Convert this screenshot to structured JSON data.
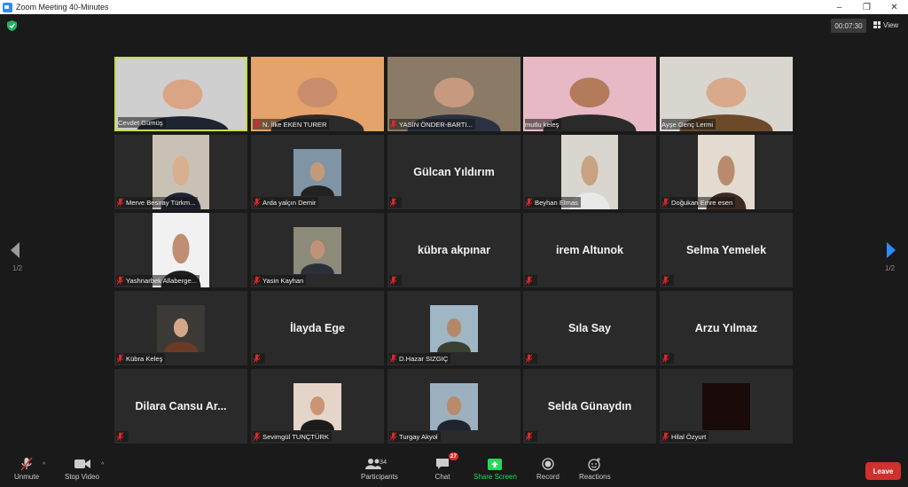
{
  "window": {
    "title": "Zoom Meeting 40-Minutes",
    "controls": [
      "–",
      "❐",
      "✕"
    ]
  },
  "meeting": {
    "timer": "00:07:30",
    "view_label": "View",
    "page_left": "1/2",
    "page_right": "1/2"
  },
  "colors": {
    "background": "#1a1a1a",
    "tile": "#2a2a2a",
    "active_speaker": "#c7dc4c",
    "muted_red": "#e02828",
    "share_green": "#23d959",
    "leave_red": "#d0312d",
    "security_green": "#1fb35c"
  },
  "participants": [
    {
      "name": "Cevdet Gümüş",
      "video": true,
      "muted": false,
      "active": true,
      "bg": "#cfcfcf",
      "fg": "#1e2430",
      "skin": "#d9a584"
    },
    {
      "name": "N. İlke EKEN TURER",
      "video": true,
      "muted": true,
      "bg": "#e4a36a",
      "fg": "#2b2b2b",
      "skin": "#c98d6e"
    },
    {
      "name": "YASİN ÖNDER-BARTI...",
      "video": true,
      "muted": true,
      "bg": "#8a7a66",
      "fg": "#2b3142",
      "skin": "#c79a80"
    },
    {
      "name": "mutlu keleş",
      "video": true,
      "muted": false,
      "bg": "#e7b9c4",
      "fg": "#2a2a2a",
      "skin": "#b37a5c"
    },
    {
      "name": "Ayşe Genç Lermi",
      "video": true,
      "muted": false,
      "bg": "#d9d6cf",
      "fg": "#6b4a2a",
      "skin": "#d8a98a"
    },
    {
      "name": "Merve Besiray Türkm...",
      "video": true,
      "muted": true,
      "bg": "#c9c1b5",
      "fg": "#1e2433",
      "skin": "#d7b08f"
    },
    {
      "name": "Arda yalçın Demir",
      "video": true,
      "muted": true,
      "bg": "#7f95a6",
      "fg": "#222",
      "skin": "#c59a7b"
    },
    {
      "name": "Gülcan Yıldırım",
      "video": false,
      "muted": true
    },
    {
      "name": "Beyhan Elmas",
      "video": true,
      "muted": true,
      "bg": "#d9d6cf",
      "fg": "#e8e8e8",
      "skin": "#c9a282"
    },
    {
      "name": "Doğukan Emre esen",
      "video": true,
      "muted": true,
      "bg": "#e3dbcf",
      "fg": "#3c2a25",
      "skin": "#b98b6c"
    },
    {
      "name": "Yashnarbek Allaberge...",
      "video": true,
      "muted": true,
      "bg": "#f1f1f1",
      "fg": "#1f1f1f",
      "skin": "#c08e72"
    },
    {
      "name": "Yasin Kayhan",
      "video": true,
      "muted": true,
      "bg": "#8c8a78",
      "fg": "#2b2f3a",
      "skin": "#c09378"
    },
    {
      "name": "kübra akpınar",
      "video": false,
      "muted": true
    },
    {
      "name": "irem Altunok",
      "video": false,
      "muted": true
    },
    {
      "name": "Selma Yemelek",
      "video": false,
      "muted": true
    },
    {
      "name": "Kübra Keleş",
      "video": true,
      "muted": true,
      "bg": "#3b3a36",
      "fg": "#6a3b24",
      "skin": "#d4a789"
    },
    {
      "name": "İlayda Ege",
      "video": false,
      "muted": true
    },
    {
      "name": "D.Hazar SIZGIÇ",
      "video": true,
      "muted": true,
      "bg": "#9fb6c4",
      "fg": "#3a4030",
      "skin": "#b4876a"
    },
    {
      "name": "Sıla Say",
      "video": false,
      "muted": true
    },
    {
      "name": "Arzu Yılmaz",
      "video": false,
      "muted": true
    },
    {
      "name": "Dilara Cansu  Ar...",
      "video": false,
      "muted": true
    },
    {
      "name": "Sevimgül TUNÇTÜRK",
      "video": true,
      "muted": true,
      "bg": "#e5d5c8",
      "fg": "#1b1b1b",
      "skin": "#c99574"
    },
    {
      "name": "Turgay Akyol",
      "video": true,
      "muted": true,
      "bg": "#9cb0c0",
      "fg": "#1f2430",
      "skin": "#b98a6b"
    },
    {
      "name": "Selda Günaydın",
      "video": false,
      "muted": true
    },
    {
      "name": "Hilal Özyurt",
      "video": true,
      "muted": true,
      "bg": "#1a0a0a",
      "fg": "#1a0a0a",
      "skin": "#1a0a0a"
    }
  ],
  "toolbar": {
    "unmute": "Unmute",
    "stop_video": "Stop Video",
    "participants": "Participants",
    "participants_count": "34",
    "chat": "Chat",
    "chat_badge": "27",
    "share_screen": "Share Screen",
    "record": "Record",
    "reactions": "Reactions",
    "leave": "Leave"
  }
}
